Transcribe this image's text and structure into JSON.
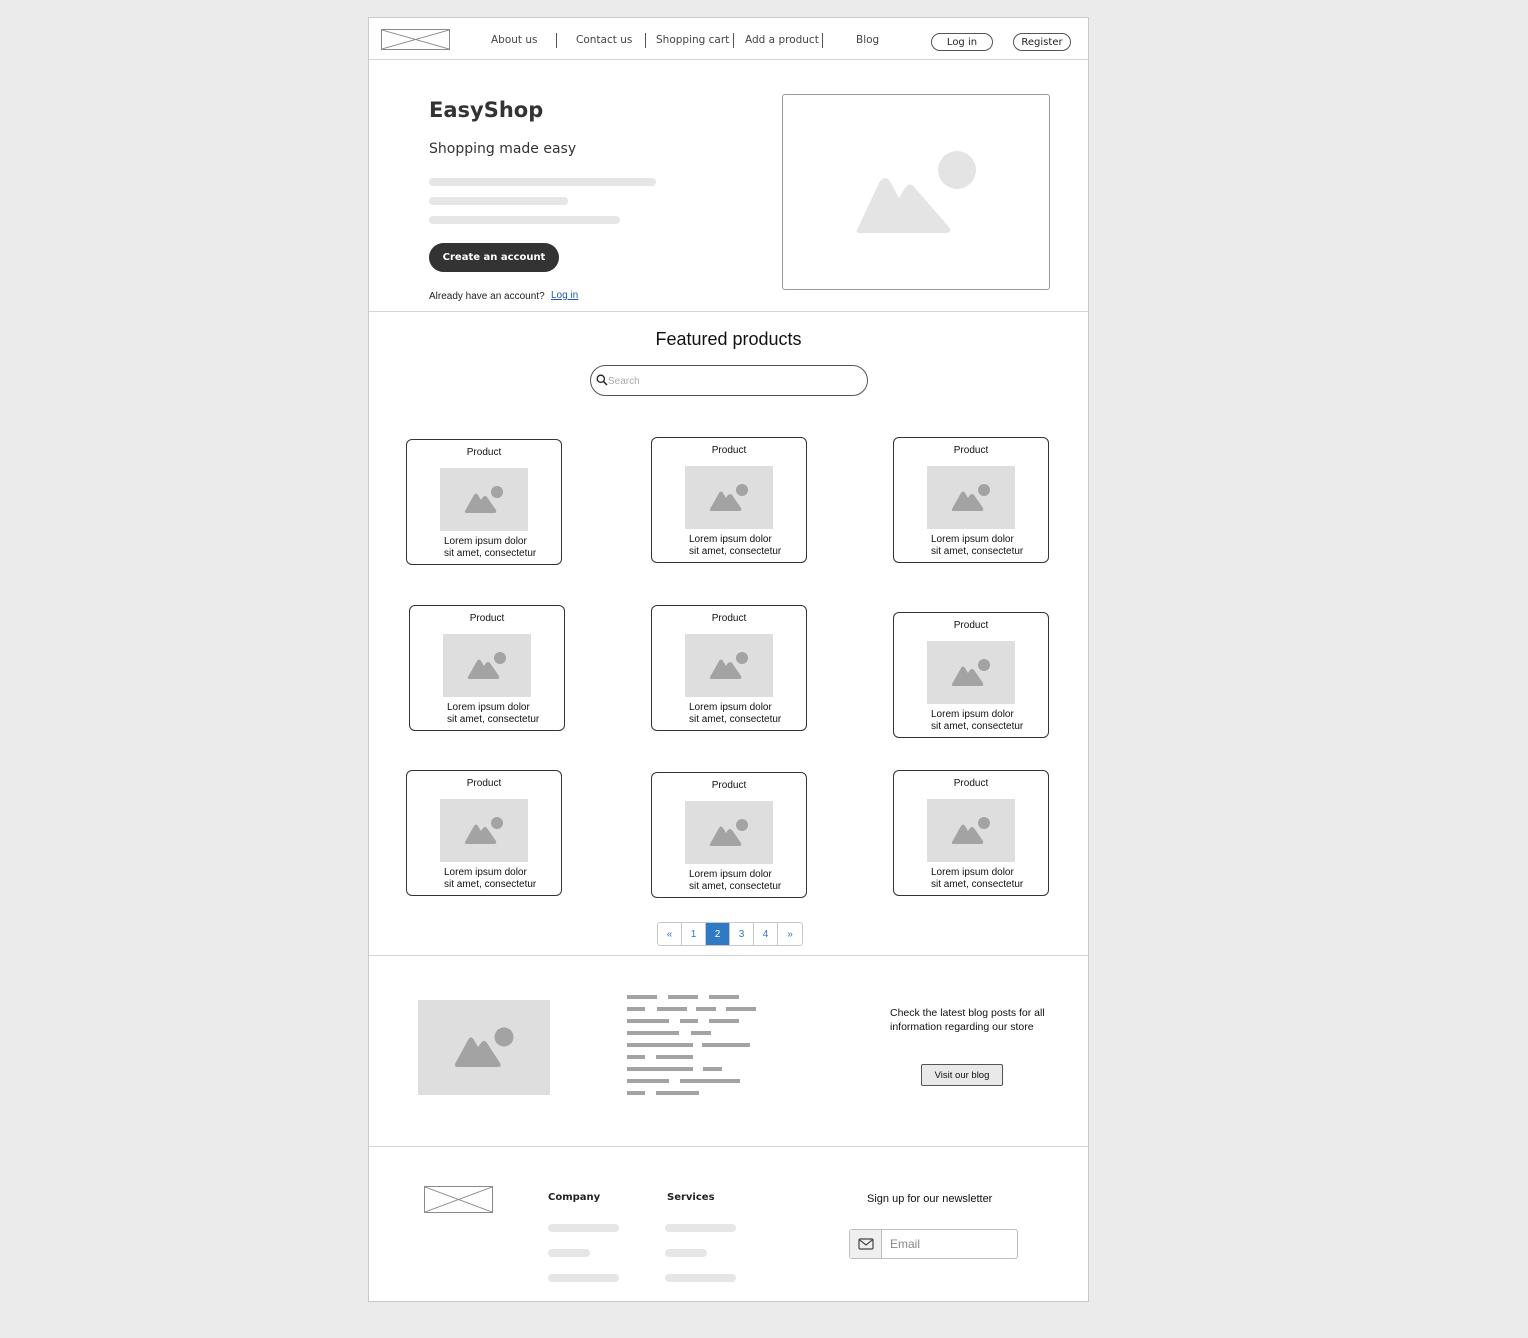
{
  "header": {
    "nav": [
      "About us",
      "Contact us",
      "Shopping cart",
      "Add a product",
      "Blog"
    ],
    "login_label": "Log in",
    "register_label": "Register"
  },
  "hero": {
    "title": "EasyShop",
    "subtitle": "Shopping made easy",
    "cta_label": "Create an account",
    "already_text": "Already have an account?",
    "login_link": "Log in"
  },
  "featured": {
    "title": "Featured products",
    "search_placeholder": "Search",
    "products": [
      {
        "title": "Product",
        "desc": "Lorem ipsum dolor\nsit amet, consectetur"
      },
      {
        "title": "Product",
        "desc": "Lorem ipsum dolor\nsit amet, consectetur"
      },
      {
        "title": "Product",
        "desc": "Lorem ipsum dolor\nsit amet, consectetur"
      },
      {
        "title": "Product",
        "desc": "Lorem ipsum dolor\nsit amet, consectetur"
      },
      {
        "title": "Product",
        "desc": "Lorem ipsum dolor\nsit amet, consectetur"
      },
      {
        "title": "Product",
        "desc": "Lorem ipsum dolor\nsit amet, consectetur"
      },
      {
        "title": "Product",
        "desc": "Lorem ipsum dolor\nsit amet, consectetur"
      },
      {
        "title": "Product",
        "desc": "Lorem ipsum dolor\nsit amet, consectetur"
      },
      {
        "title": "Product",
        "desc": "Lorem ipsum dolor\nsit amet, consectetur"
      }
    ]
  },
  "pagination": {
    "prev": "«",
    "pages": [
      "1",
      "2",
      "3",
      "4"
    ],
    "active_page": "2",
    "next": "»"
  },
  "blog": {
    "text": "Check the latest blog posts for all information regarding our store",
    "button_label": "Visit our blog"
  },
  "footer": {
    "company_heading": "Company",
    "services_heading": "Services",
    "newsletter_text": "Sign up for our newsletter",
    "email_placeholder": "Email"
  },
  "colors": {
    "accent": "#2f7ac6",
    "cta_bg": "#333333",
    "placeholder_gray": "#dedede"
  },
  "icons": [
    "logo-placeholder-icon",
    "image-placeholder-icon",
    "search-icon",
    "envelope-icon"
  ]
}
